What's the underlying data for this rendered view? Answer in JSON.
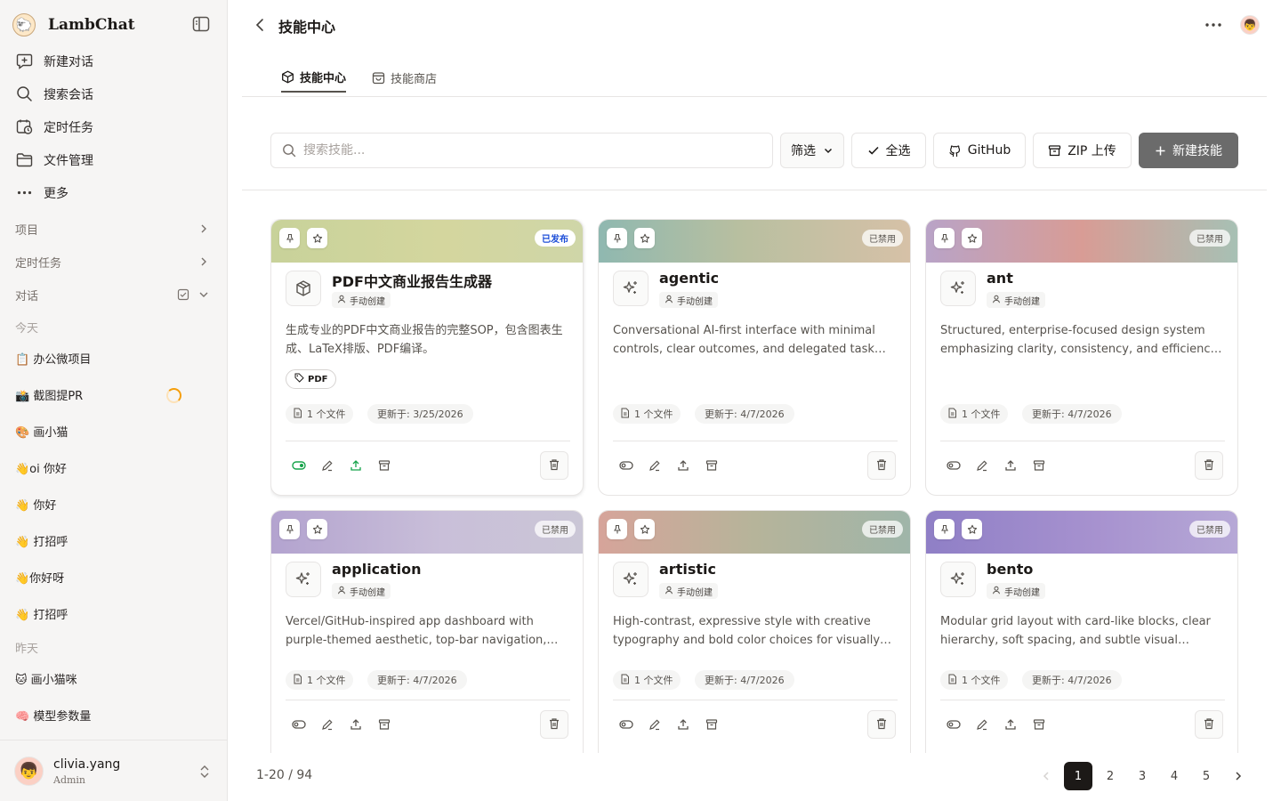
{
  "app": {
    "name": "LambChat",
    "logo_glyph": "🐑"
  },
  "sidebar": {
    "nav": [
      {
        "label": "新建对话",
        "icon": "new-chat-icon"
      },
      {
        "label": "搜索会话",
        "icon": "search-icon"
      },
      {
        "label": "定时任务",
        "icon": "schedule-icon"
      },
      {
        "label": "文件管理",
        "icon": "folder-icon"
      },
      {
        "label": "更多",
        "icon": "more-icon"
      }
    ],
    "sections": {
      "projects": "项目",
      "scheduled": "定时任务",
      "conversations": "对话"
    },
    "groups": {
      "today": "今天",
      "yesterday": "昨天"
    },
    "today": [
      "📋 办公微项目",
      "📸 截图提PR",
      "🎨 画小猫",
      "👋oi 你好",
      "👋 你好",
      "👋 打招呼",
      "👋你好呀",
      "👋 打招呼"
    ],
    "yesterday": [
      "🐱 画小猫咪",
      "🧠 模型参数量"
    ],
    "user": {
      "name": "clivia.yang",
      "role": "Admin",
      "avatar_glyph": "👦"
    }
  },
  "header": {
    "title": "技能中心",
    "avatar_glyph": "👦"
  },
  "tabs": [
    {
      "label": "技能中心",
      "icon": "box-icon",
      "active": true
    },
    {
      "label": "技能商店",
      "icon": "store-icon",
      "active": false
    }
  ],
  "toolbar": {
    "search_placeholder": "搜索技能...",
    "filter": "筛选",
    "select_all": "全选",
    "github": "GitHub",
    "zip_upload": "ZIP 上传",
    "new_skill": "新建技能"
  },
  "cards": [
    {
      "name": "PDF中文商业报告生成器",
      "status": "已发布",
      "source": "手动创建",
      "description": "生成专业的PDF中文商业报告的完整SOP，包含图表生成、LaTeX排版、PDF编译。",
      "tag": "PDF",
      "files": "1 个文件",
      "updated": "更新于: 3/25/2026",
      "icon": "package-icon",
      "enabled": true,
      "banner": "linear-gradient(90deg,#c8d29a 0%,#d4d69e 55%,#cfd6a8 100%)"
    },
    {
      "name": "agentic",
      "status": "已禁用",
      "source": "手动创建",
      "description": "Conversational AI-first interface with minimal controls, clear outcomes, and delegated task…",
      "files": "1 个文件",
      "updated": "更新于: 4/7/2026",
      "icon": "sparkle-icon",
      "enabled": false,
      "banner": "linear-gradient(90deg,#8fb8b0 0%,#b8bfa0 45%,#d6c1a7 100%)"
    },
    {
      "name": "ant",
      "status": "已禁用",
      "source": "手动创建",
      "description": "Structured, enterprise-focused design system emphasizing clarity, consistency, and efficienc…",
      "files": "1 个文件",
      "updated": "更新于: 4/7/2026",
      "icon": "sparkle-icon",
      "enabled": false,
      "banner": "linear-gradient(90deg,#b9a3c7 0%,#d89c95 50%,#a7c0b4 100%)"
    },
    {
      "name": "application",
      "status": "已禁用",
      "source": "手动创建",
      "description": "Vercel/GitHub-inspired app dashboard with purple-themed aesthetic, top-bar navigation,…",
      "files": "1 个文件",
      "updated": "更新于: 4/7/2026",
      "icon": "sparkle-icon",
      "enabled": false,
      "banner": "linear-gradient(90deg,#b3a3cf 0%,#c9bfd9 55%,#cac6d6 100%)"
    },
    {
      "name": "artistic",
      "status": "已禁用",
      "source": "手动创建",
      "description": "High-contrast, expressive style with creative typography and bold color choices for visually…",
      "files": "1 个文件",
      "updated": "更新于: 4/7/2026",
      "icon": "sparkle-icon",
      "enabled": false,
      "banner": "linear-gradient(90deg,#d6a49a 0%,#b6b49a 50%,#9fb5a9 100%)"
    },
    {
      "name": "bento",
      "status": "已禁用",
      "source": "手动创建",
      "description": "Modular grid layout with card-like blocks, clear hierarchy, soft spacing, and subtle visual…",
      "files": "1 个文件",
      "updated": "更新于: 4/7/2026",
      "icon": "sparkle-icon",
      "enabled": false,
      "banner": "linear-gradient(90deg,#8f7fc6 0%,#a792cf 55%,#b6a8d6 100%)"
    }
  ],
  "pagination": {
    "range": "1-20 / 94",
    "pages": [
      "1",
      "2",
      "3",
      "4",
      "5"
    ],
    "current": "1"
  },
  "colors": {
    "accent_green": "#16a34a",
    "primary_button": "#6b6b6b",
    "published_blue": "#1d4ed8"
  }
}
